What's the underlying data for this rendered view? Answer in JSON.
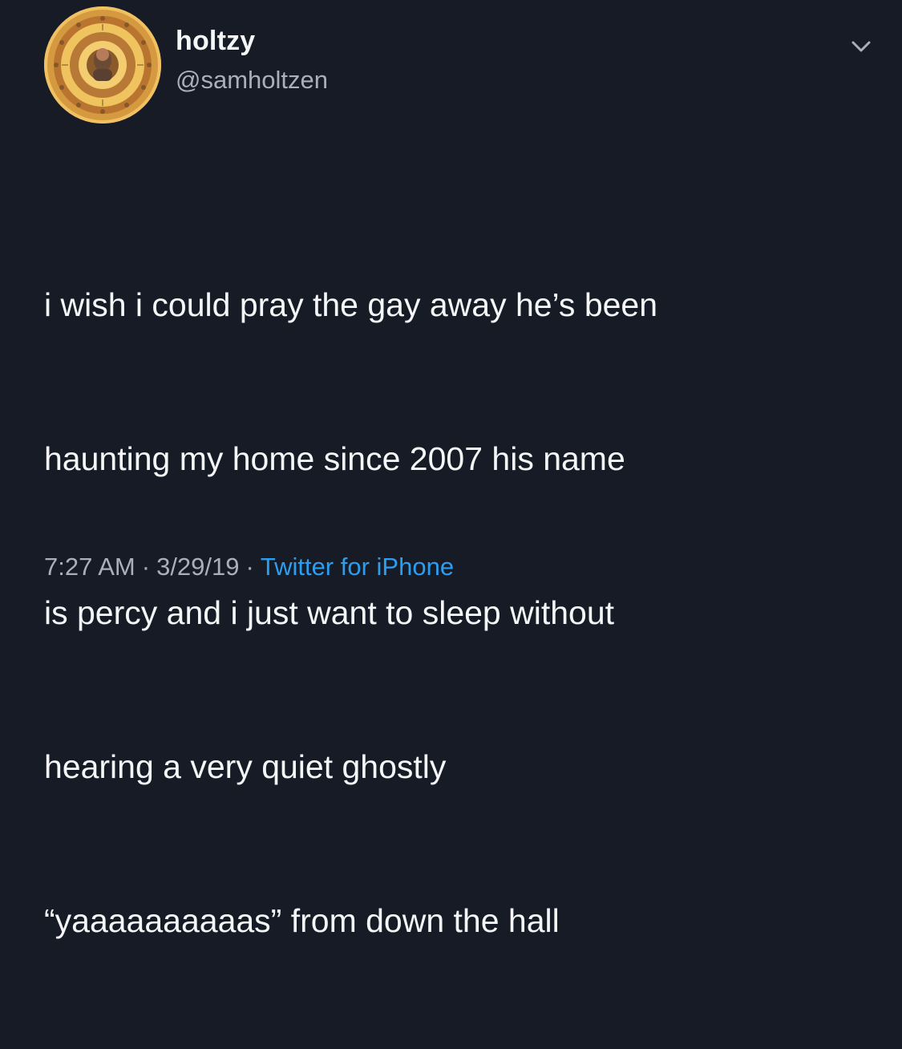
{
  "tweet": {
    "author": {
      "display_name": "holtzy",
      "handle": "@samholtzen",
      "avatar_icon": "circular-gold-medallion-avatar"
    },
    "text_lines": [
      "i wish i could pray the gay away he’s been",
      "haunting my home since 2007 his name",
      "is percy and i just want to sleep without",
      "hearing a very quiet ghostly",
      "“yaaaaaaaaaas” from down the hall"
    ],
    "meta": {
      "time": "7:27 AM",
      "date": "3/29/19",
      "source": "Twitter for iPhone",
      "separator": "·"
    },
    "menu_icon": "chevron-down-icon"
  },
  "colors": {
    "background": "#161b26",
    "text": "#f5f6f7",
    "muted": "#a7b0bb",
    "accent": "#2c9ef0"
  }
}
